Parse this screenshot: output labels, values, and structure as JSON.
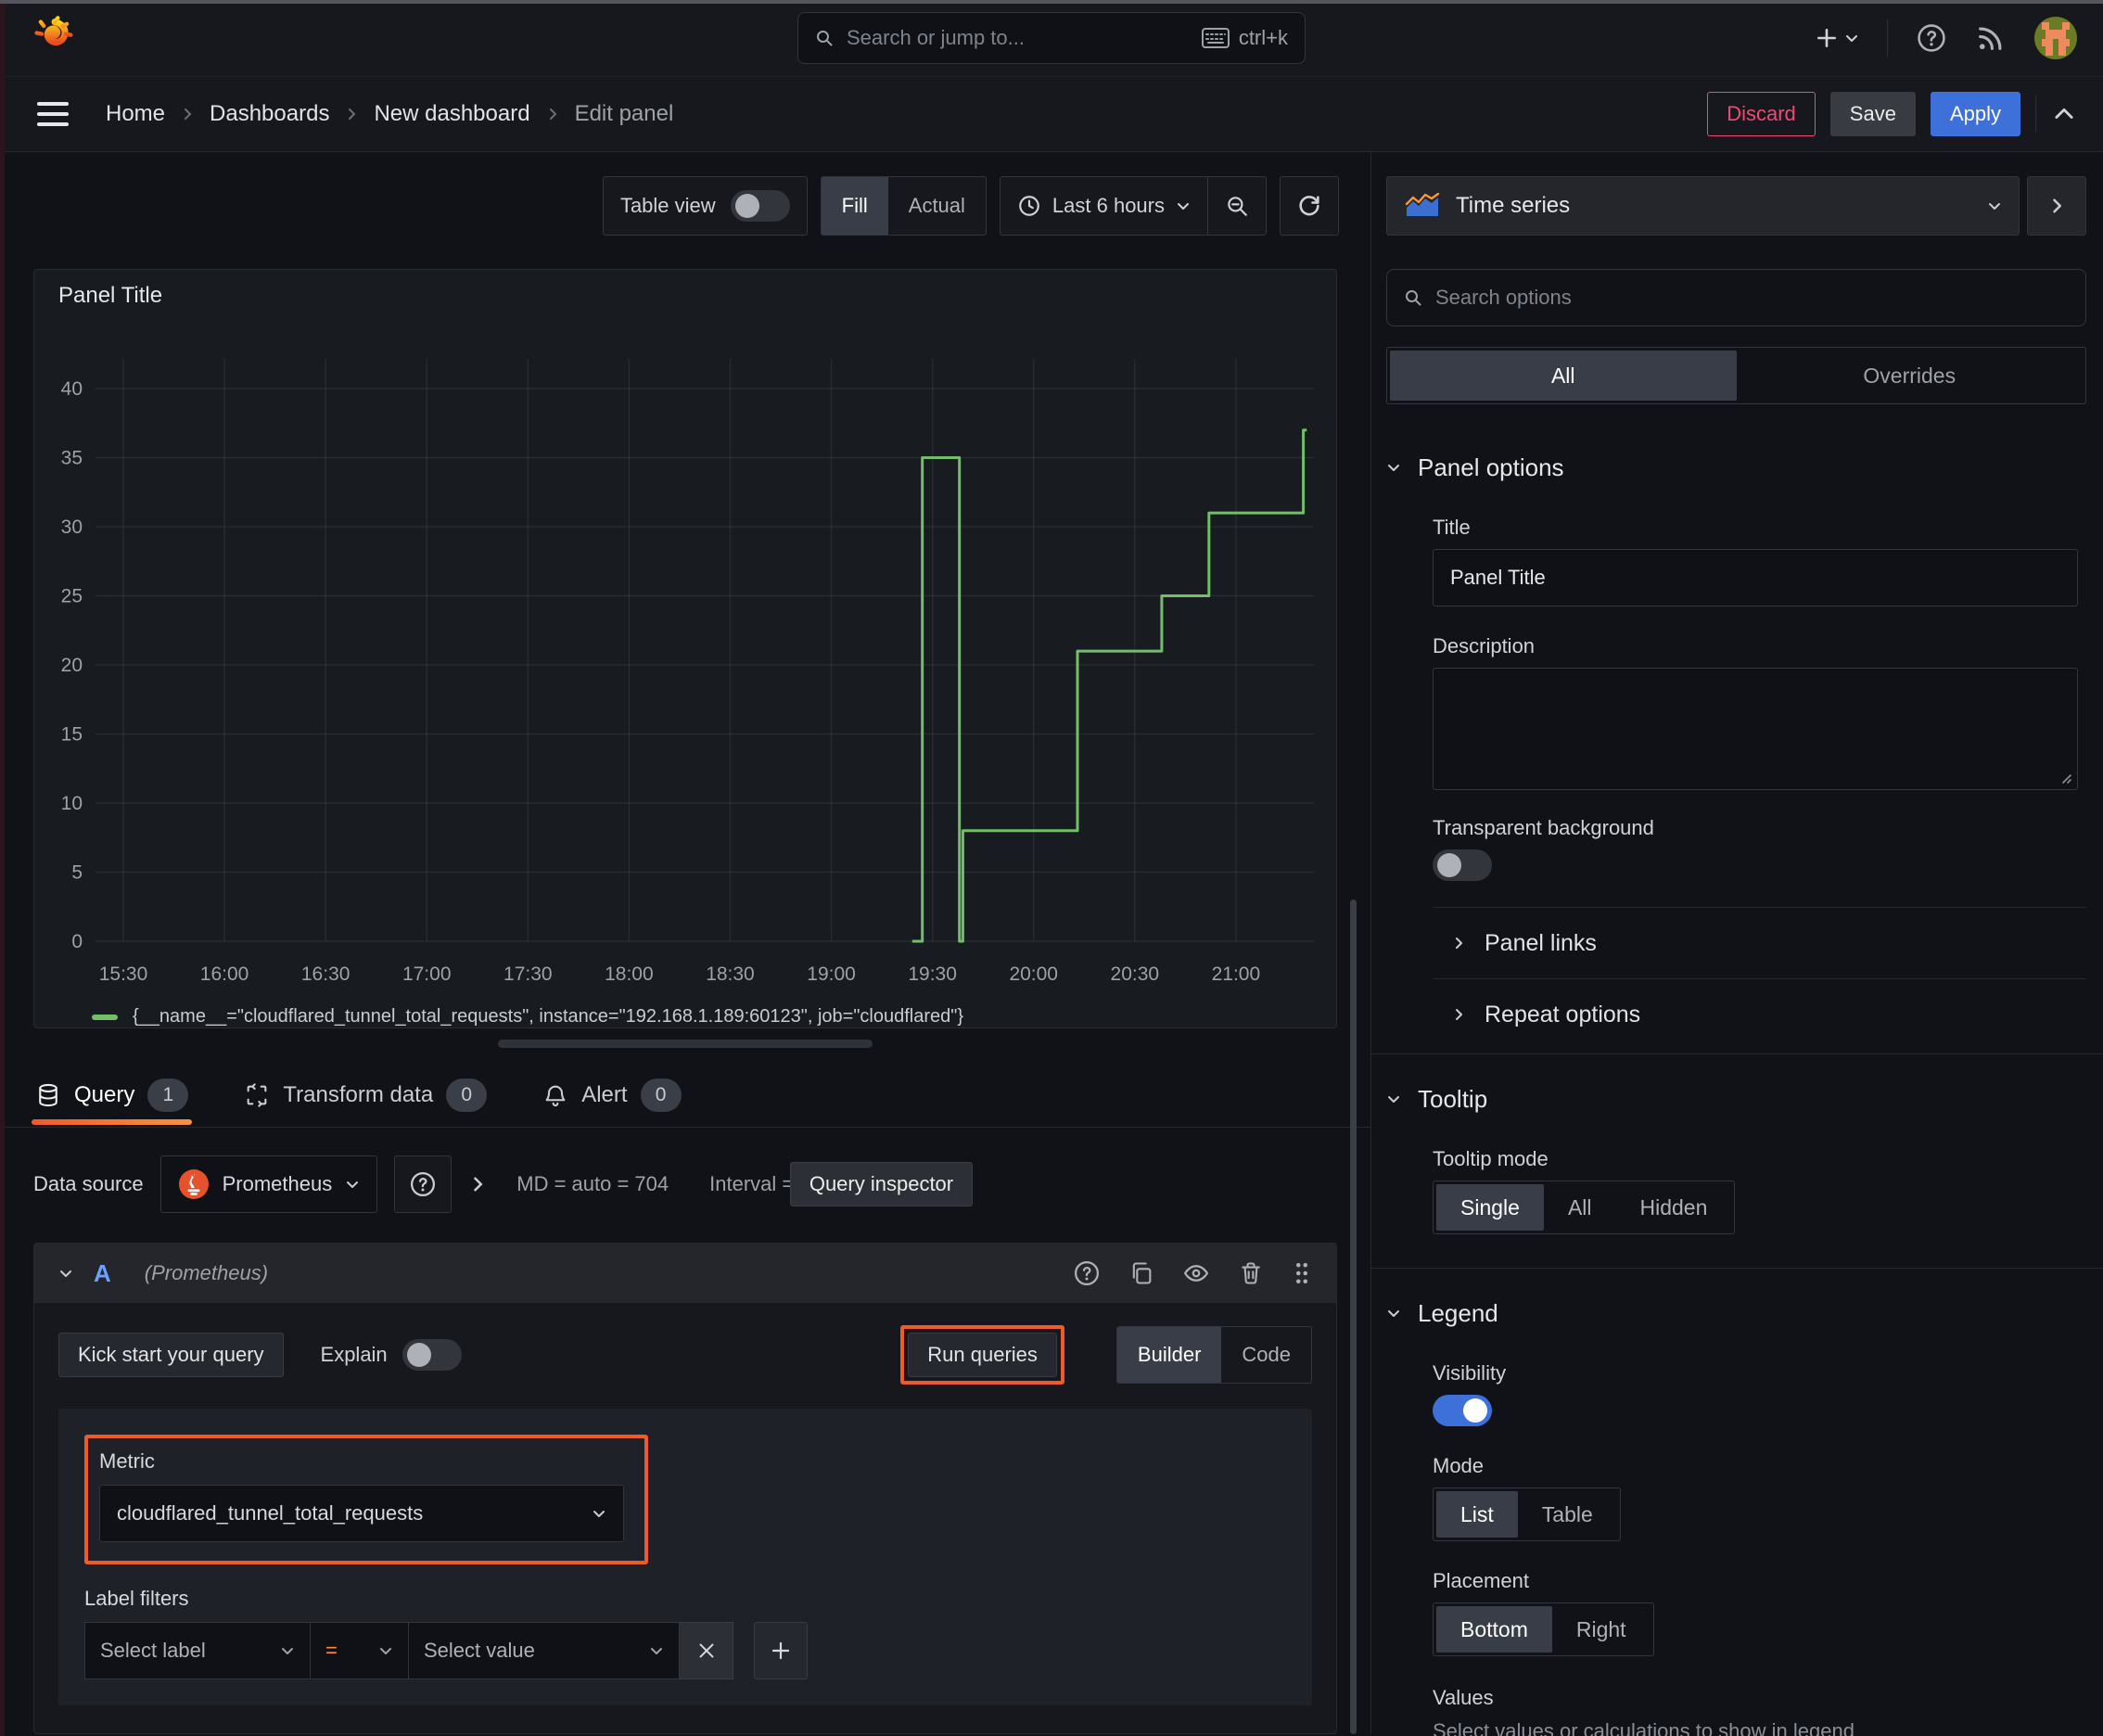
{
  "topnav": {
    "search_placeholder": "Search or jump to...",
    "shortcut": "ctrl+k"
  },
  "breadcrumb": {
    "items": [
      "Home",
      "Dashboards",
      "New dashboard",
      "Edit panel"
    ]
  },
  "actions": {
    "discard": "Discard",
    "save": "Save",
    "apply": "Apply"
  },
  "toolbar": {
    "table_view": "Table view",
    "fill": "Fill",
    "actual": "Actual",
    "time_range": "Last 6 hours"
  },
  "panel": {
    "title": "Panel Title",
    "legend": "{__name__=\"cloudflared_tunnel_total_requests\", instance=\"192.168.1.189:60123\", job=\"cloudflared\"}"
  },
  "chart_data": {
    "type": "line",
    "title": "Panel Title",
    "xlabel": "",
    "ylabel": "",
    "x_ticks": [
      "15:30",
      "16:00",
      "16:30",
      "17:00",
      "17:30",
      "18:00",
      "18:30",
      "19:00",
      "19:30",
      "20:00",
      "20:30",
      "21:00"
    ],
    "y_ticks": [
      0,
      5,
      10,
      15,
      20,
      25,
      30,
      35,
      40
    ],
    "ylim": [
      0,
      40
    ],
    "grid": true,
    "legend_position": "bottom",
    "series": [
      {
        "name": "{__name__=\"cloudflared_tunnel_total_requests\", instance=\"192.168.1.189:60123\", job=\"cloudflared\"}",
        "color": "#73bf69",
        "points": [
          [
            "19:24",
            0
          ],
          [
            "19:27",
            0
          ],
          [
            "19:27",
            35
          ],
          [
            "19:38",
            35
          ],
          [
            "19:38",
            0
          ],
          [
            "19:39",
            0
          ],
          [
            "19:39",
            8
          ],
          [
            "20:13",
            8
          ],
          [
            "20:13",
            21
          ],
          [
            "20:38",
            21
          ],
          [
            "20:38",
            25
          ],
          [
            "20:52",
            25
          ],
          [
            "20:52",
            31
          ],
          [
            "21:20",
            31
          ],
          [
            "21:20",
            37
          ],
          [
            "21:21",
            37
          ]
        ]
      }
    ]
  },
  "tabs": {
    "query": "Query",
    "query_count": "1",
    "transform": "Transform data",
    "transform_count": "0",
    "alert": "Alert",
    "alert_count": "0"
  },
  "datasource": {
    "label": "Data source",
    "name": "Prometheus",
    "stats_md": "MD = auto = 704",
    "stats_interval": "Interval = 30s",
    "inspector": "Query inspector"
  },
  "query_row": {
    "ref_id": "A",
    "ds_hint": "(Prometheus)",
    "kick_start": "Kick start your query",
    "explain": "Explain",
    "run": "Run queries",
    "builder": "Builder",
    "code": "Code",
    "metric_label": "Metric",
    "metric_value": "cloudflared_tunnel_total_requests",
    "label_filters": "Label filters",
    "select_label": "Select label",
    "operator": "=",
    "select_value": "Select value"
  },
  "sidebar": {
    "viz": "Time series",
    "search_placeholder": "Search options",
    "tab_all": "All",
    "tab_overrides": "Overrides",
    "panel_options": {
      "heading": "Panel options",
      "title_label": "Title",
      "title_value": "Panel Title",
      "description_label": "Description",
      "transparent": "Transparent background"
    },
    "panel_links": "Panel links",
    "repeat_options": "Repeat options",
    "tooltip": {
      "heading": "Tooltip",
      "mode_label": "Tooltip mode",
      "single": "Single",
      "all": "All",
      "hidden": "Hidden"
    },
    "legend": {
      "heading": "Legend",
      "visibility": "Visibility",
      "mode": "Mode",
      "list": "List",
      "table": "Table",
      "placement": "Placement",
      "bottom": "Bottom",
      "right": "Right",
      "values": "Values",
      "values_help": "Select values or calculations to show in legend"
    }
  },
  "colors": {
    "series_green": "#73bf69",
    "accent_blue": "#3d71d9",
    "discard_pink": "#f04a73",
    "annotation_orange": "#ee5b28",
    "tab_underline": "#f05a28"
  }
}
